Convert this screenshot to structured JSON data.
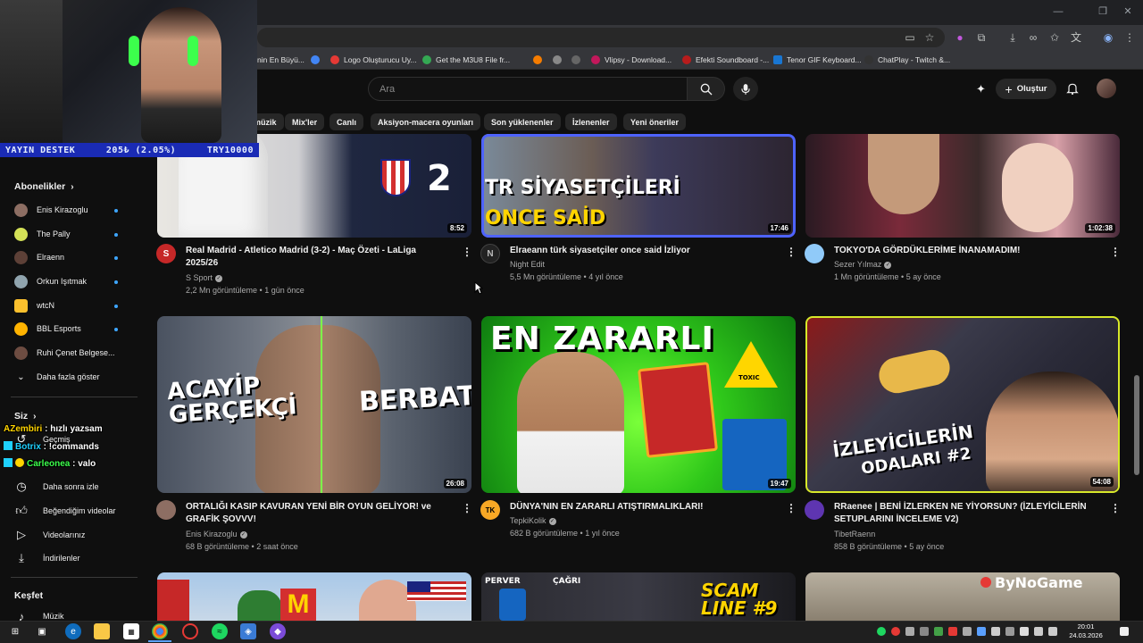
{
  "browser": {
    "bookmarks": [
      {
        "label": "nin En Büyü...",
        "color": "#444"
      },
      {
        "label": "",
        "color": "#4285f4"
      },
      {
        "label": "Logo Oluşturucu Uy...",
        "color": "#e53935"
      },
      {
        "label": "Get the M3U8 File fr...",
        "color": "#34a853"
      },
      {
        "label": "",
        "color": "#f57c00"
      },
      {
        "label": "",
        "color": "#888"
      },
      {
        "label": "",
        "color": "#666"
      },
      {
        "label": "Vlipsy - Download...",
        "color": "#c2185b"
      },
      {
        "label": "Efekti Soundboard -...",
        "color": "#b71c1c"
      },
      {
        "label": "Tenor GIF Keyboard...",
        "color": "#1976d2"
      },
      {
        "label": "ChatPlay - Twitch &...",
        "color": "#333"
      }
    ]
  },
  "search": {
    "placeholder": "Ara"
  },
  "header": {
    "create_label": "Oluştur"
  },
  "chips": [
    "müzik",
    "Mix'ler",
    "Canlı",
    "Aksiyon-macera oyunları",
    "Son yüklenenler",
    "İzlenenler",
    "Yeni öneriler"
  ],
  "sidebar": {
    "subscriptions_title": "Abonelikler",
    "subscriptions": [
      {
        "name": "Enis Kirazoglu",
        "color": "#8d6e63"
      },
      {
        "name": "The Pally",
        "color": "#d4e157"
      },
      {
        "name": "Elraenn",
        "color": "#5d4037"
      },
      {
        "name": "Orkun Işıtmak",
        "color": "#90a4ae"
      },
      {
        "name": "wtcN",
        "color": "#fbc02d"
      },
      {
        "name": "BBL Esports",
        "color": "#ffb300"
      },
      {
        "name": "Ruhi Çenet Belgese...",
        "color": "#6d4c41"
      }
    ],
    "show_more": "Daha fazla göster",
    "you_title": "Siz",
    "you_items": [
      {
        "label": "Geçmiş",
        "icon": "history-icon"
      },
      {
        "label": "Daha sonra izle",
        "icon": "clock-icon"
      },
      {
        "label": "Beğendiğim videolar",
        "icon": "thumbs-up-icon"
      },
      {
        "label": "Videolarınız",
        "icon": "play-square-icon"
      },
      {
        "label": "İndirilenler",
        "icon": "download-icon"
      }
    ],
    "explore_title": "Keşfet",
    "explore_items": [
      {
        "label": "Müzik",
        "icon": "music-icon"
      }
    ]
  },
  "overlay": {
    "donation_label": "YAYIN DESTEK",
    "donation_amount": "205₺ (2.05%)",
    "donation_target": "TRY10000",
    "chat": [
      {
        "user": "AZembiri",
        "text": " : hızlı yazsam",
        "color": "#ffd400"
      },
      {
        "user": "Botrix",
        "text": " : !commands",
        "color": "#1fd1ff"
      },
      {
        "user": "Carleonea",
        "text": " : valo",
        "color": "#3cff4c"
      }
    ]
  },
  "videos": [
    {
      "title_line1": "Real Madrid - Atletico Madrid (3-2) - Maç Özeti - LaLiga",
      "title_line2": "2025/26",
      "channel": "S Sport",
      "verified": true,
      "stats": "2,2 Mn görüntüleme • 1 gün önce",
      "duration": "8:52",
      "thumb_text": "2",
      "avatar": "S",
      "avatar_color": "#c62828"
    },
    {
      "title_line1": "Elraeann türk siyasetçiler once said İzliyor",
      "title_line2": "",
      "channel": "Night Edit",
      "verified": false,
      "stats": "5,5 Mn görüntüleme • 4 yıl önce",
      "duration": "17:46",
      "thumb_text": "TR SİYASETÇİLERİ",
      "thumb_text2": "ONCE SAİD",
      "avatar": "N",
      "avatar_color": "#222"
    },
    {
      "title_line1": "TOKYO'DA GÖRDÜKLERİME İNANAMADIM!",
      "title_line2": "",
      "channel": "Sezer Yılmaz",
      "verified": true,
      "stats": "1 Mn görüntüleme • 5 ay önce",
      "duration": "1:02:38",
      "avatar": "",
      "avatar_color": "#90caf9"
    },
    {
      "title_line1": "ORTALIĞI KASIP KAVURAN YENİ BİR OYUN GELİYOR! ve",
      "title_line2": "GRAFİK ŞOVVV!",
      "channel": "Enis Kirazoglu",
      "verified": true,
      "stats": "68 B görüntüleme • 2 saat önce",
      "duration": "26:08",
      "thumb_text": "ACAYİP GERÇEKÇİ",
      "thumb_text2": "BERBAT!",
      "avatar": "",
      "avatar_color": "#8d6e63"
    },
    {
      "title_line1": "DÜNYA'NIN EN ZARARLI ATIŞTIRMALIKLARI!",
      "title_line2": "",
      "channel": "TepkiKolik",
      "verified": true,
      "stats": "682 B görüntüleme • 1 yıl önce",
      "duration": "19:47",
      "thumb_text": "EN ZARARLI",
      "thumb_text2": "TOXIC",
      "avatar": "TK",
      "avatar_color": "#f9a825"
    },
    {
      "title_line1": "RRaenee | BENİ İZLERKEN NE YİYORSUN? (İZLEYİCİLERİN",
      "title_line2": "SETUPLARINI İNCELEME V2)",
      "channel": "TibetRaenn",
      "verified": false,
      "stats": "858 B görüntüleme • 5 ay önce",
      "duration": "54:08",
      "thumb_text": "İZLEYİCİLERİN",
      "thumb_text2": "ODALARI #2",
      "avatar": "",
      "avatar_color": "#5e35b1"
    },
    {
      "thumb_text": "",
      "avatar_color": "#c62828"
    },
    {
      "thumb_text": "PERVER",
      "thumb_text2": "ÇAĞRI",
      "thumb_text3": "SCAM LINE #9"
    },
    {
      "thumb_text": "ByNoGame"
    }
  ],
  "taskbar": {
    "time": "20:01",
    "date": "24.03.2026"
  }
}
